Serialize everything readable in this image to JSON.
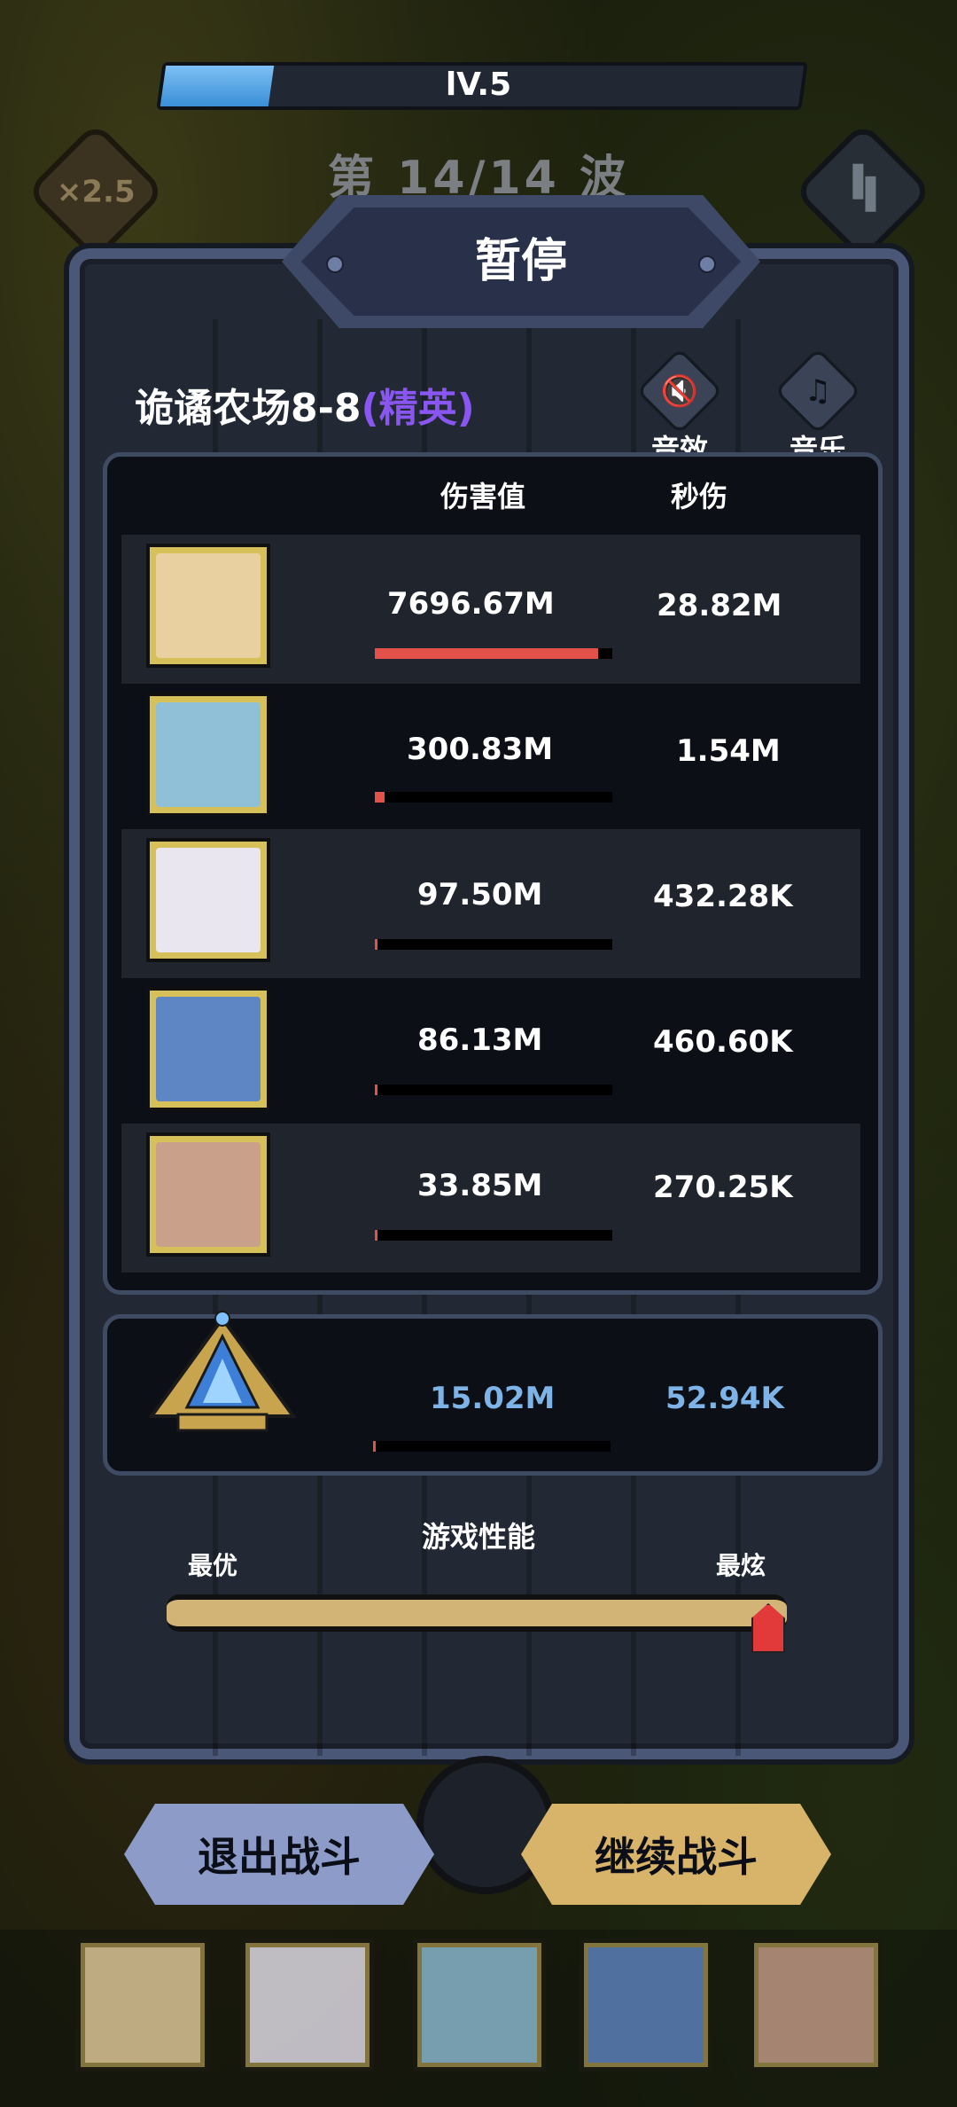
{
  "level": {
    "label": "lV.5",
    "progress": 0.17
  },
  "wave": "第 14/14 波",
  "speed": "×2.5",
  "pause_dialog": {
    "title": "暂停",
    "stage_name": "诡谲农场8-8",
    "stage_tag": "(精英)",
    "sound_label": "音效",
    "music_label": "音乐",
    "headers": {
      "damage": "伤害值",
      "dps": "秒伤"
    },
    "heroes": [
      {
        "damage": "7696.67M",
        "dps": "28.82M",
        "share": 0.94,
        "color": "#e8d0a0"
      },
      {
        "damage": "300.83M",
        "dps": "1.54M",
        "share": 0.04,
        "color": "#8fc0d8"
      },
      {
        "damage": "97.50M",
        "dps": "432.28K",
        "share": 0.013,
        "color": "#e9e6f0"
      },
      {
        "damage": "86.13M",
        "dps": "460.60K",
        "share": 0.011,
        "color": "#5f86c4"
      },
      {
        "damage": "33.85M",
        "dps": "270.25K",
        "share": 0.004,
        "color": "#c9a08a"
      }
    ],
    "summon": {
      "damage": "15.02M",
      "dps": "52.94K",
      "share": 0.002
    },
    "performance": {
      "title": "游戏性能",
      "left": "最优",
      "right": "最炫",
      "value": 1.0
    },
    "exit_button": "退出战斗",
    "continue_button": "继续战斗"
  },
  "colors": {
    "accent_red": "#e2524a",
    "summon_blue": "#7db3e6",
    "elite_purple": "#8a56f2"
  }
}
